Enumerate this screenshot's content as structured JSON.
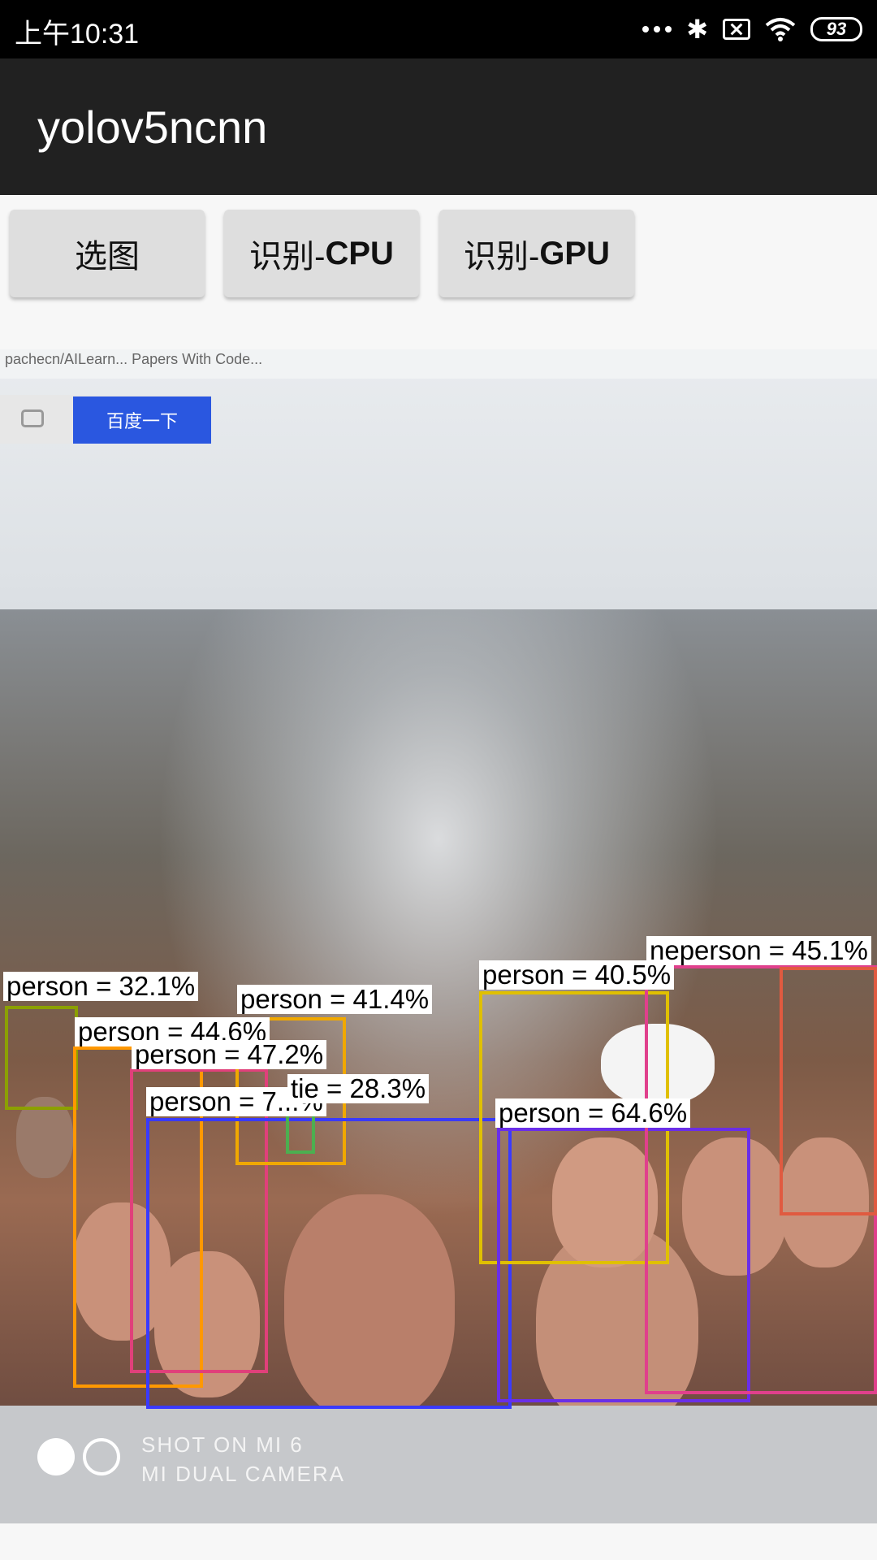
{
  "status_bar": {
    "time": "上午10:31",
    "battery": "93",
    "icons": [
      "more-dots-icon",
      "bluetooth-icon",
      "no-sim-icon",
      "wifi-icon",
      "battery-icon"
    ]
  },
  "app": {
    "title": "yolov5ncnn"
  },
  "buttons": {
    "select_image": "选图",
    "detect_cpu_prefix": "识别-",
    "detect_cpu_suffix": "CPU",
    "detect_gpu_prefix": "识别-",
    "detect_gpu_suffix": "GPU"
  },
  "photo": {
    "baidu_button": "百度一下",
    "browser_tabs": "pachecn/AILearn...   Papers With Code...",
    "watermark_line1": "SHOT ON MI 6",
    "watermark_line2": "MI DUAL CAMERA"
  },
  "detections": [
    {
      "label": "person = 32.1%",
      "color": "#8ca000"
    },
    {
      "label": "person = 44.6%",
      "color": "#ff9800"
    },
    {
      "label": "person = 47.2%",
      "color": "#e0407a"
    },
    {
      "label": "person = 41.4%",
      "color": "#f0a800"
    },
    {
      "label": "person = 7...%",
      "color": "#3a3aff"
    },
    {
      "label": "tie = 28.3%",
      "color": "#4caf50"
    },
    {
      "label": "person = 40.5%",
      "color": "#e0c000"
    },
    {
      "label": "person = 64.6%",
      "color": "#6a2ee8"
    },
    {
      "label": "neperson = 45.1%",
      "color": "#e0408c"
    },
    {
      "label": "",
      "color": "#e05a40"
    }
  ]
}
